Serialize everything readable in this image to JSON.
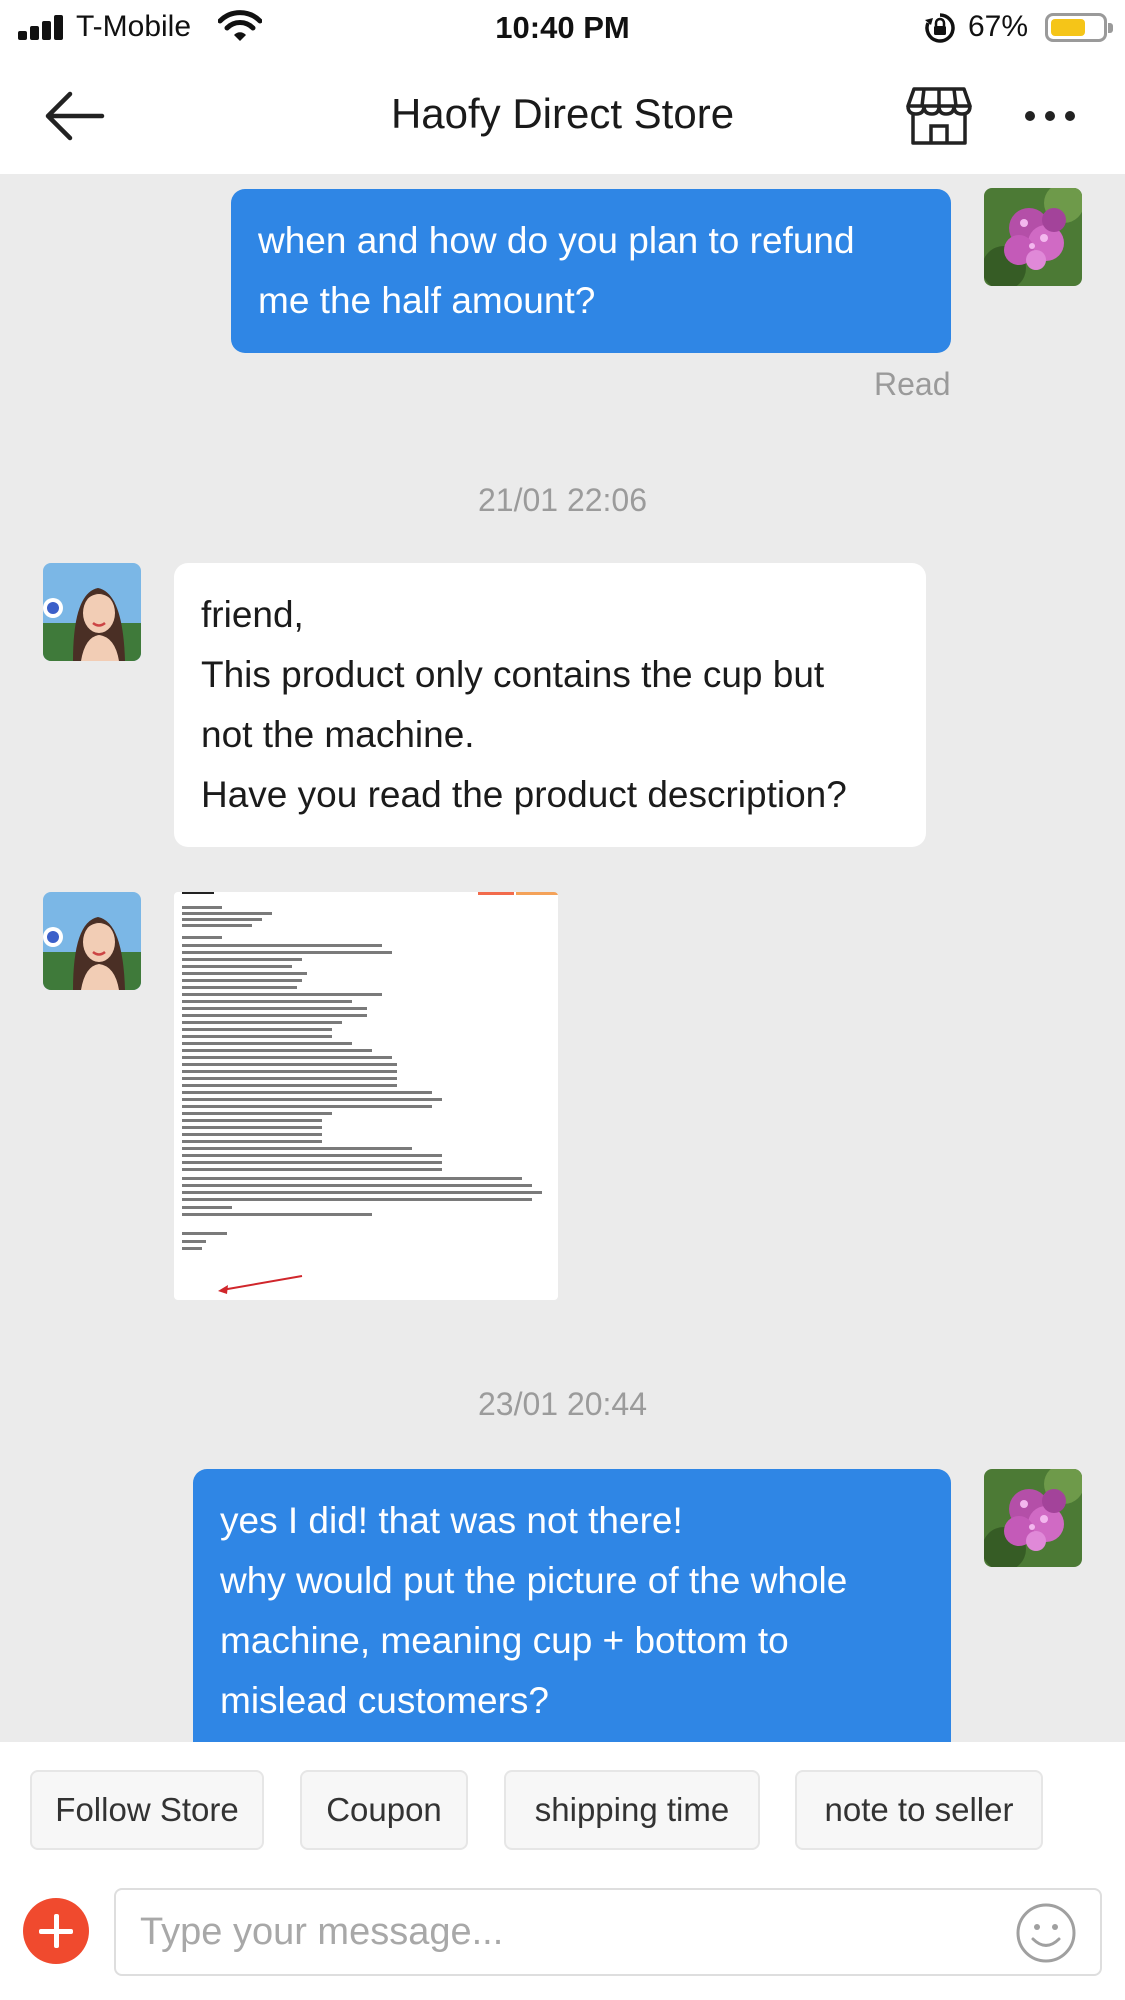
{
  "status_bar": {
    "carrier": "T-Mobile",
    "time": "10:40 PM",
    "battery_percent": "67%",
    "battery_level": 0.67,
    "signal_icon": "signal-bars-icon",
    "wifi_icon": "wifi-icon",
    "rotation_lock_icon": "rotation-lock-icon",
    "battery_color": "#f5c518"
  },
  "header": {
    "title": "Haofy Direct Store",
    "back_icon": "back-arrow-icon",
    "store_icon": "store-icon",
    "more_icon": "more-dots-icon"
  },
  "messages": [
    {
      "direction": "outgoing",
      "lines": [
        "when and how do you plan to refund",
        "me the half amount?"
      ],
      "status": "Read"
    },
    {
      "type": "timestamp",
      "text": "21/01 22:06"
    },
    {
      "direction": "incoming",
      "lines": [
        "friend,",
        "This product only contains the cup but",
        "not the machine.",
        "Have you read the product description?"
      ]
    },
    {
      "direction": "incoming",
      "type": "image",
      "image_description_icon": "product-description-image"
    },
    {
      "type": "timestamp",
      "text": "23/01 20:44"
    },
    {
      "direction": "outgoing",
      "lines": [
        "yes I did! that was not there!",
        "why would put the picture of the whole",
        "machine, meaning cup + bottom to",
        "mislead customers?"
      ]
    }
  ],
  "quick_replies": [
    "Follow Store",
    "Coupon",
    "shipping time",
    "note to seller"
  ],
  "composer": {
    "placeholder": "Type your message...",
    "add_icon": "plus-icon",
    "emoji_icon": "smiley-icon"
  },
  "colors": {
    "outgoing_bubble": "#2f86e5",
    "incoming_bubble": "#ffffff",
    "chat_background": "#ebebeb",
    "add_button": "#f04a2e"
  }
}
